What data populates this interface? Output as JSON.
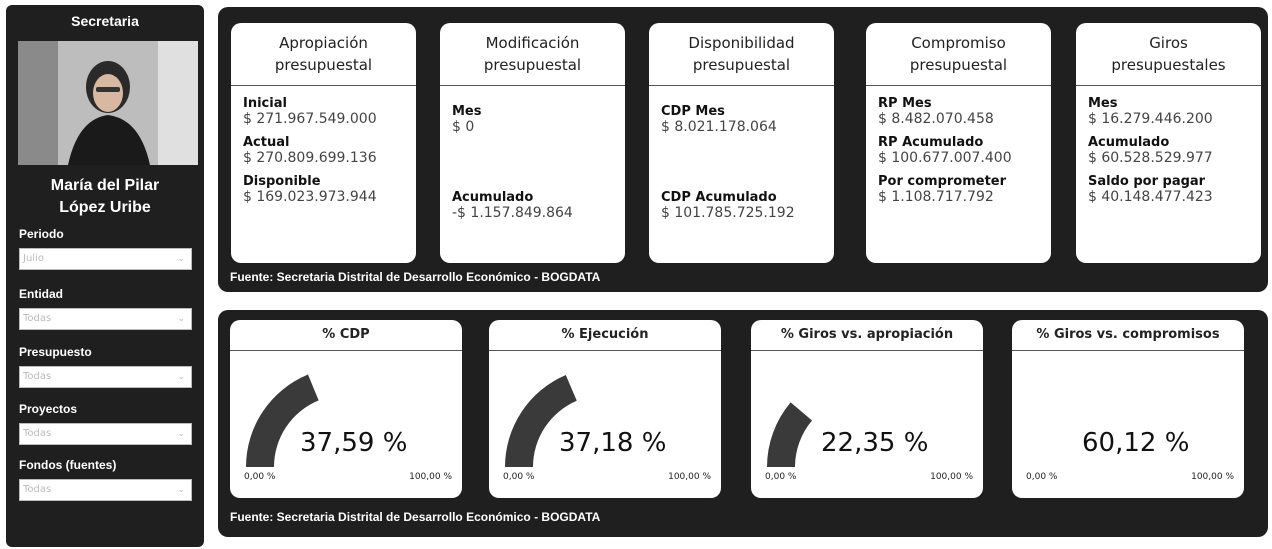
{
  "sidebar": {
    "title": "Secretaria",
    "person_name_line1": "María del Pilar",
    "person_name_line2": "López Uribe",
    "filters": [
      {
        "label": "Periodo",
        "value": "Julio"
      },
      {
        "label": "Entidad",
        "value": "Todas"
      },
      {
        "label": "Presupuesto",
        "value": "Todas"
      },
      {
        "label": "Proyectos",
        "value": "Todas"
      },
      {
        "label": "Fondos (fuentes)",
        "value": "Todas"
      }
    ]
  },
  "kpis": [
    {
      "title1": "Apropiación",
      "title2": "presupuestal",
      "rows": [
        {
          "label": "Inicial",
          "value": "$ 271.967.549.000"
        },
        {
          "label": "Actual",
          "value": "$ 270.809.699.136"
        },
        {
          "label": "Disponible",
          "value": "$ 169.023.973.944"
        }
      ]
    },
    {
      "title1": "Modificación",
      "title2": "presupuestal",
      "rows": [
        {
          "label": "Mes",
          "value": "$ 0"
        },
        {
          "label": "Acumulado",
          "value": "-$ 1.157.849.864"
        }
      ]
    },
    {
      "title1": "Disponibilidad",
      "title2": "presupuestal",
      "rows": [
        {
          "label": "CDP Mes",
          "value": "$ 8.021.178.064"
        },
        {
          "label": "CDP Acumulado",
          "value": "$ 101.785.725.192"
        }
      ]
    },
    {
      "title1": "Compromiso",
      "title2": "presupuestal",
      "rows": [
        {
          "label": "RP Mes",
          "value": "$ 8.482.070.458"
        },
        {
          "label": "RP Acumulado",
          "value": "$ 100.677.007.400"
        },
        {
          "label": "Por comprometer",
          "value": "$ 1.108.717.792"
        }
      ]
    },
    {
      "title1": "Giros",
      "title2": "presupuestales",
      "rows": [
        {
          "label": "Mes",
          "value": "$ 16.279.446.200"
        },
        {
          "label": "Acumulado",
          "value": "$ 60.528.529.977"
        },
        {
          "label": "Saldo por pagar",
          "value": "$ 40.148.477.423"
        }
      ]
    }
  ],
  "source_top": "Fuente: Secretaria Distrital de Desarrollo Económico - BOGDATA",
  "source_bottom": "Fuente: Secretaria Distrital de Desarrollo Económico - BOGDATA",
  "gauges": [
    {
      "title": "% CDP",
      "value_text": "37,59 %",
      "percent": 37.59,
      "min_label": "0,00 %",
      "max_label": "100,00 %",
      "show_arc": true
    },
    {
      "title": "% Ejecución",
      "value_text": "37,18 %",
      "percent": 37.18,
      "min_label": "0,00 %",
      "max_label": "100,00 %",
      "show_arc": true
    },
    {
      "title": "% Giros vs. apropiación",
      "value_text": "22,35 %",
      "percent": 22.35,
      "min_label": "0,00 %",
      "max_label": "100,00 %",
      "show_arc": true
    },
    {
      "title": "% Giros vs. compromisos",
      "value_text": "60,12 %",
      "percent": 60.12,
      "min_label": "0,00 %",
      "max_label": "100,00 %",
      "show_arc": false
    }
  ],
  "colors": {
    "panel_bg": "#1f1f1f",
    "card_bg": "#ffffff",
    "gauge_fill": "#3a3a3a"
  }
}
